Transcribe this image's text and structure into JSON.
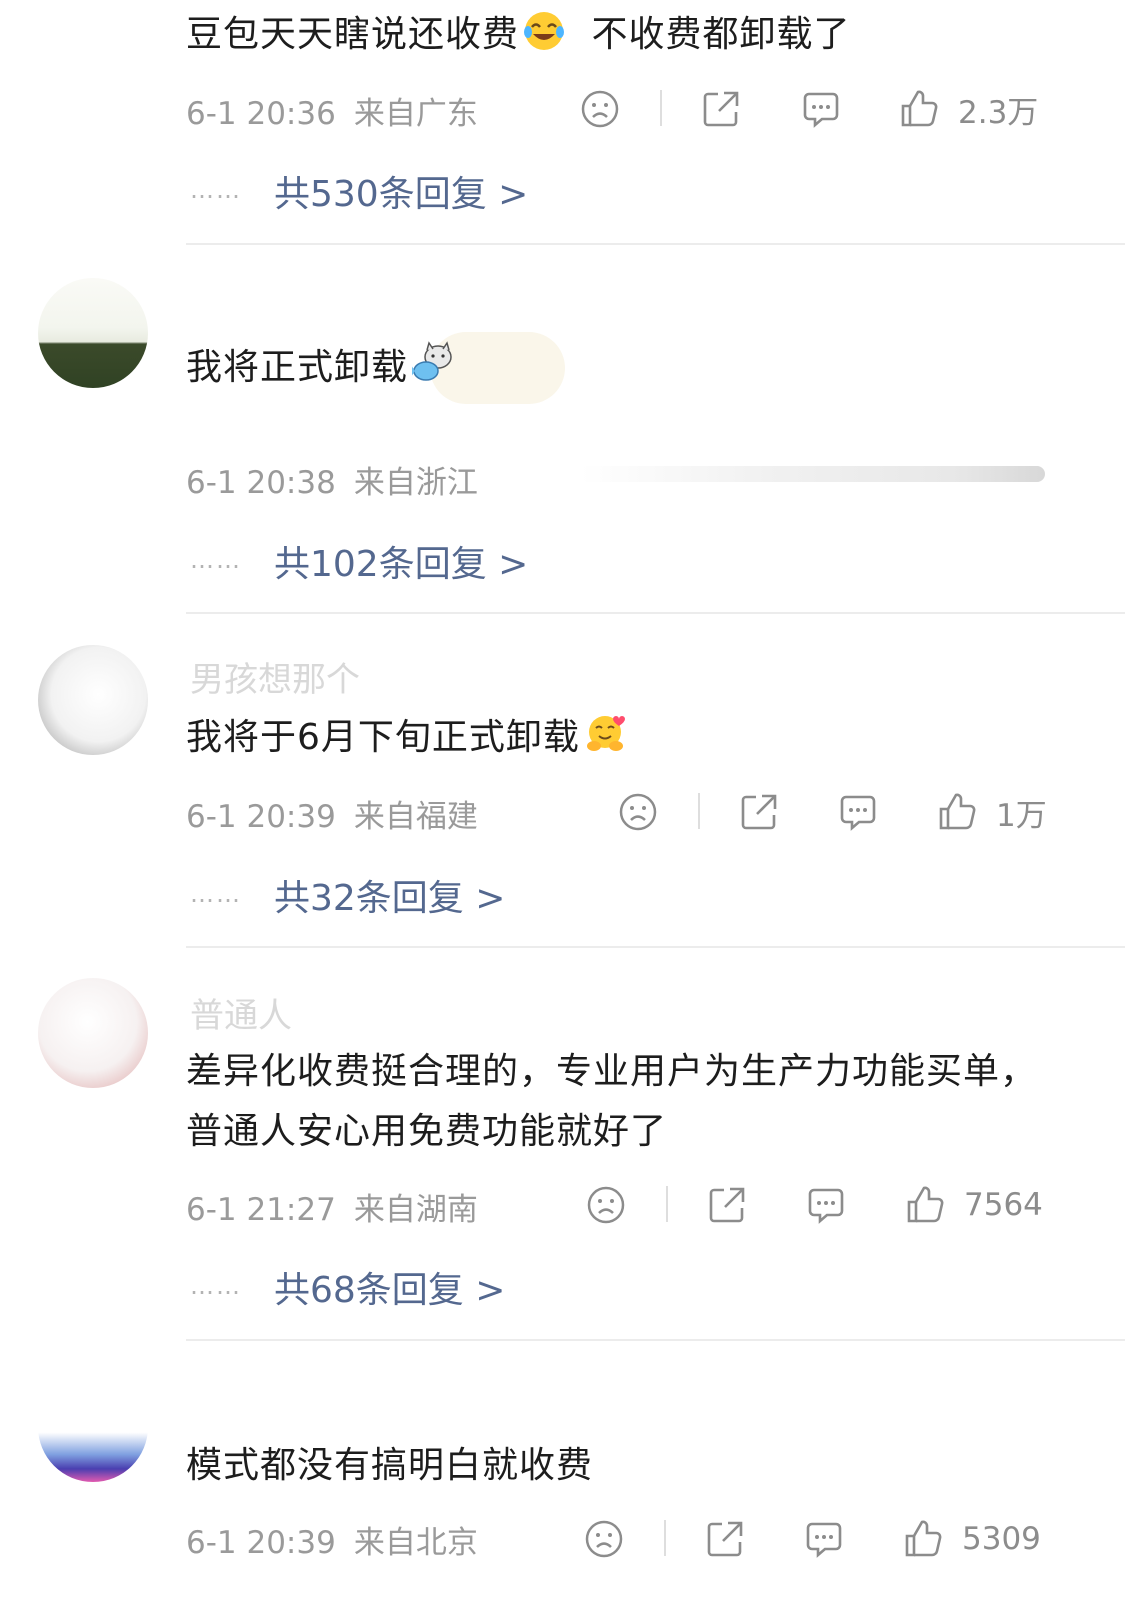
{
  "comments": [
    {
      "text": "豆包天天瞎说还收费",
      "text_after_emoji": "不收费都卸载了",
      "emoji": "laughing-tears-emoji",
      "time": "6-1 20:36",
      "location": "来自广东",
      "likes": "2.3万",
      "replies": "共530条回复 >"
    },
    {
      "username": "",
      "text": "我将正式卸载",
      "emoji": "cat-fish-sticker",
      "time": "6-1 20:38",
      "location": "来自浙江",
      "replies": "共102条回复 >"
    },
    {
      "username": "男孩想那个",
      "text": "我将于6月下旬正式卸载",
      "emoji": "hugging-face-emoji",
      "time": "6-1 20:39",
      "location": "来自福建",
      "likes": "1万",
      "replies": "共32条回复 >"
    },
    {
      "username": "普通人",
      "text": "差异化收费挺合理的，专业用户为生产力功能买单，普通人安心用免费功能就好了",
      "time": "6-1 21:27",
      "location": "来自湖南",
      "likes": "7564",
      "replies": "共68条回复 >"
    },
    {
      "username": "",
      "text": "模式都没有搞明白就收费",
      "time": "6-1 20:39",
      "location": "来自北京",
      "likes": "5309"
    }
  ],
  "reply_dots": "……",
  "icons": [
    "sad-face-icon",
    "share-icon",
    "comment-icon",
    "thumbs-up-icon"
  ],
  "colors": {
    "reply_link": "#54688f",
    "meta": "#9a9a9a",
    "icon": "#8c8c8c"
  }
}
